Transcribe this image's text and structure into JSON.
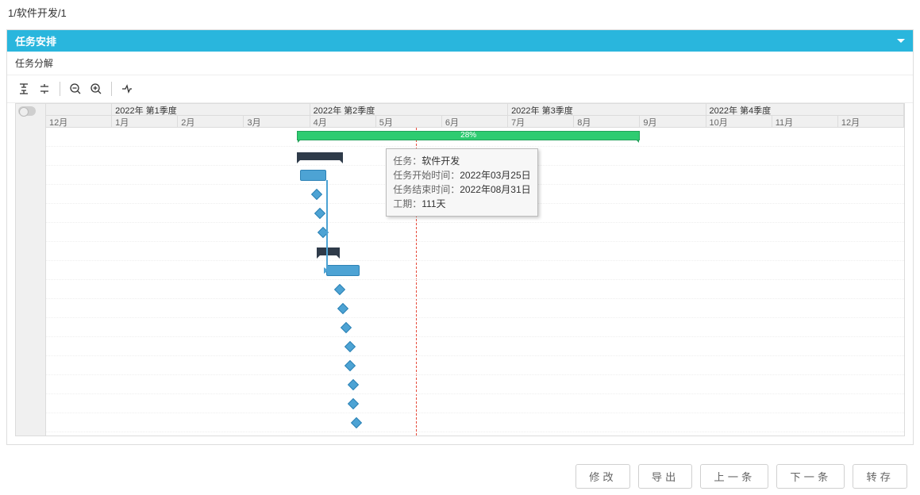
{
  "breadcrumb": "1/软件开发/1",
  "panel": {
    "title": "任务安排",
    "subtitle": "任务分解"
  },
  "toolbar": {
    "expand_all": "全部展开",
    "collapse_all": "全部收起",
    "zoom_out": "缩小",
    "zoom_in": "放大",
    "critical_path": "关键路径"
  },
  "timeline": {
    "quarters": [
      "",
      "2022年 第1季度",
      "2022年 第2季度",
      "2022年 第3季度",
      "2022年 第4季度"
    ],
    "quarter_spans": [
      1,
      3,
      3,
      3,
      3
    ],
    "months": [
      "12月",
      "1月",
      "2月",
      "3月",
      "4月",
      "5月",
      "6月",
      "7月",
      "8月",
      "9月",
      "10月",
      "11月",
      "12月"
    ],
    "today_month_offset": 5.6
  },
  "summary": {
    "start_month": 3.8,
    "end_month": 9.0,
    "percent_label": "28%"
  },
  "tooltip": {
    "task_label": "任务：",
    "task_value": "软件开发",
    "start_label": "任务开始时间：",
    "start_value": "2022年03月25日",
    "end_label": "任务结束时间：",
    "end_value": "2022年08月31日",
    "duration_label": "工期：",
    "duration_value": "111天",
    "left_month": 5.15,
    "top_row": 1
  },
  "footer": {
    "edit": "修改",
    "export": "导出",
    "prev": "上一条",
    "next": "下一条",
    "save_as": "转存"
  },
  "chart_data": {
    "type": "gantt",
    "title": "任务分解",
    "time_axis": {
      "unit": "month",
      "start": "2021-12",
      "end": "2022-12"
    },
    "today": "2022-05-18",
    "summary": {
      "name": "软件开发",
      "start": "2022-03-25",
      "end": "2022-08-31",
      "progress": 0.28
    },
    "tasks": [
      {
        "row": 1,
        "type": "group",
        "start_month": 3.8,
        "end_month": 4.5
      },
      {
        "row": 2,
        "type": "task",
        "start_month": 3.85,
        "end_month": 4.25
      },
      {
        "row": 3,
        "type": "milestone",
        "month": 4.1
      },
      {
        "row": 4,
        "type": "milestone",
        "month": 4.15
      },
      {
        "row": 5,
        "type": "milestone",
        "month": 4.2
      },
      {
        "row": 6,
        "type": "group",
        "start_month": 4.1,
        "end_month": 4.45
      },
      {
        "row": 7,
        "type": "task",
        "start_month": 4.25,
        "end_month": 4.75
      },
      {
        "row": 8,
        "type": "milestone",
        "month": 4.45
      },
      {
        "row": 9,
        "type": "milestone",
        "month": 4.5
      },
      {
        "row": 10,
        "type": "milestone",
        "month": 4.55
      },
      {
        "row": 11,
        "type": "milestone",
        "month": 4.6
      },
      {
        "row": 12,
        "type": "milestone",
        "month": 4.6
      },
      {
        "row": 13,
        "type": "milestone",
        "month": 4.65
      },
      {
        "row": 14,
        "type": "milestone",
        "month": 4.65
      },
      {
        "row": 15,
        "type": "milestone",
        "month": 4.7
      }
    ],
    "links": [
      {
        "from_row": 2,
        "from_month": 4.25,
        "to_row": 7,
        "to_month": 4.25
      }
    ]
  }
}
